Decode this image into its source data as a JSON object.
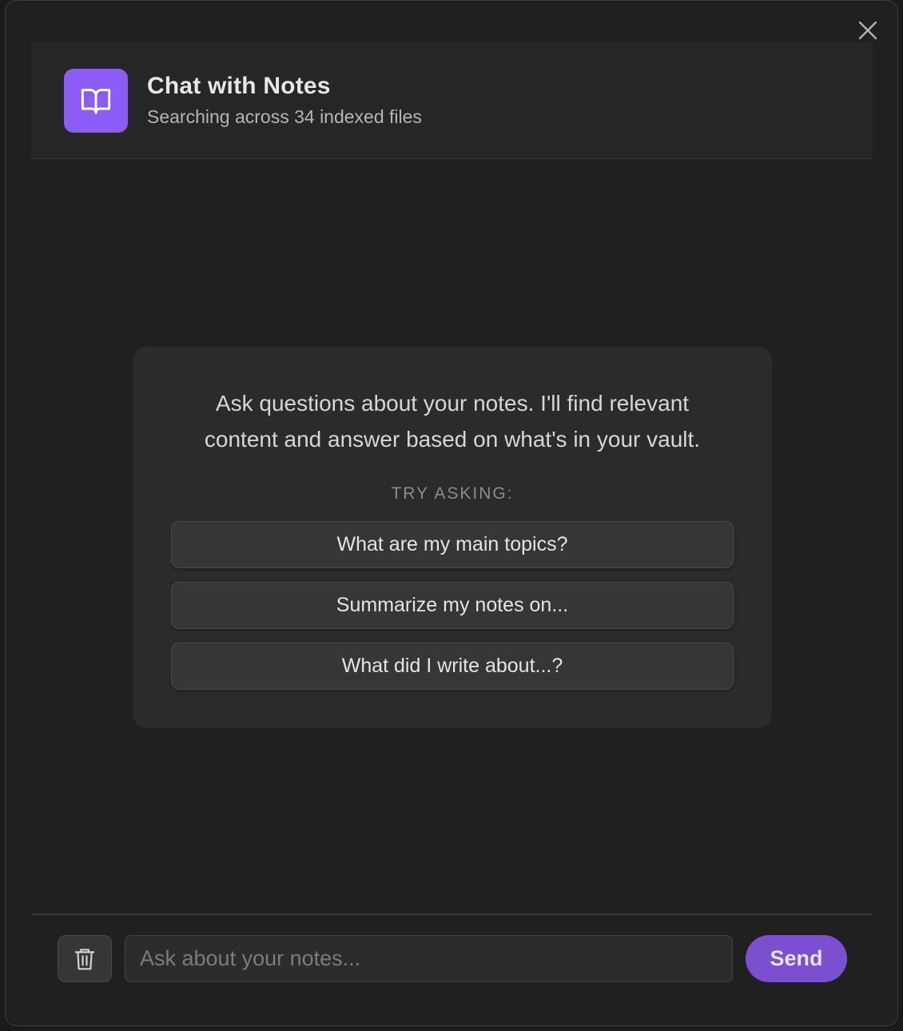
{
  "header": {
    "icon": "book-open-icon",
    "title": "Chat with Notes",
    "subtitle": "Searching across 34 indexed files"
  },
  "close_icon": "close-icon",
  "empty_state": {
    "intro_line1": "Ask questions about your notes. I'll find relevant",
    "intro_line2": "content and answer based on what's in your vault.",
    "try_label": "TRY ASKING:",
    "suggestions": [
      "What are my main topics?",
      "Summarize my notes on...",
      "What did I write about...?"
    ]
  },
  "footer": {
    "clear_icon": "trash-icon",
    "input_placeholder": "Ask about your notes...",
    "input_value": "",
    "send_label": "Send"
  },
  "colors": {
    "accent": "#8b5cf6",
    "send_button": "#7c4fd0",
    "modal_bg": "#202020",
    "card_bg": "#2b2b2b"
  }
}
